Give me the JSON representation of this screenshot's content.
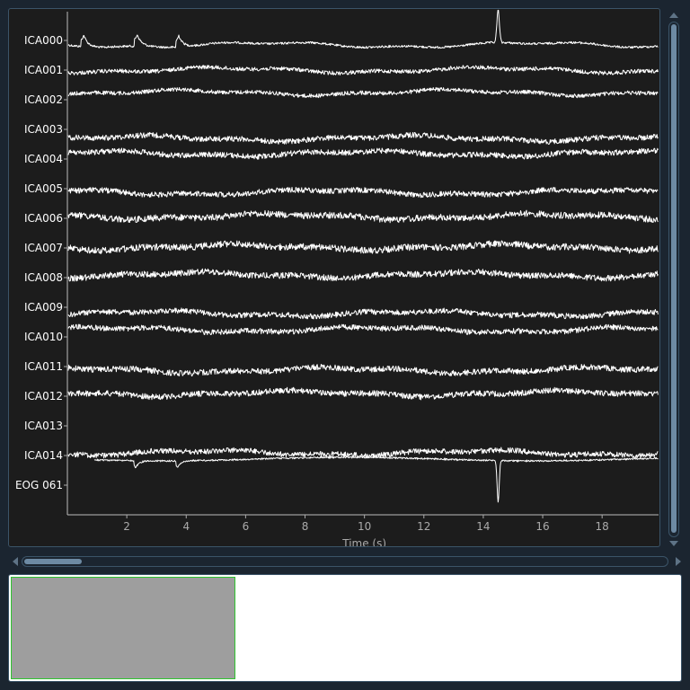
{
  "chart_data": {
    "type": "line",
    "xlabel": "Time (s)",
    "xlim": [
      0,
      19.9
    ],
    "xticks": [
      2,
      4,
      6,
      8,
      10,
      12,
      14,
      16,
      18
    ],
    "channels": [
      "ICA000",
      "ICA001",
      "ICA002",
      "ICA003",
      "ICA004",
      "ICA005",
      "ICA006",
      "ICA007",
      "ICA008",
      "ICA009",
      "ICA010",
      "ICA011",
      "ICA012",
      "ICA013",
      "ICA014",
      "EOG 061"
    ],
    "grid": false,
    "trace_color": "#ffffff",
    "background": "#1c1c1c",
    "events": [
      {
        "channel": "ICA000",
        "t": [
          0.5,
          2.3,
          3.7
        ],
        "shape": "spike-up"
      },
      {
        "channel": "ICA000",
        "t": [
          14.5
        ],
        "shape": "large-spike-up"
      },
      {
        "channel": "EOG 061",
        "t": [
          14.5
        ],
        "shape": "large-spike-down"
      }
    ]
  },
  "colors": {
    "panel_border": "#3b5468",
    "scrollbar_thumb": "#6d8aa3",
    "overview_window": "#9e9e9e",
    "overview_window_border": "#2fc42f"
  }
}
